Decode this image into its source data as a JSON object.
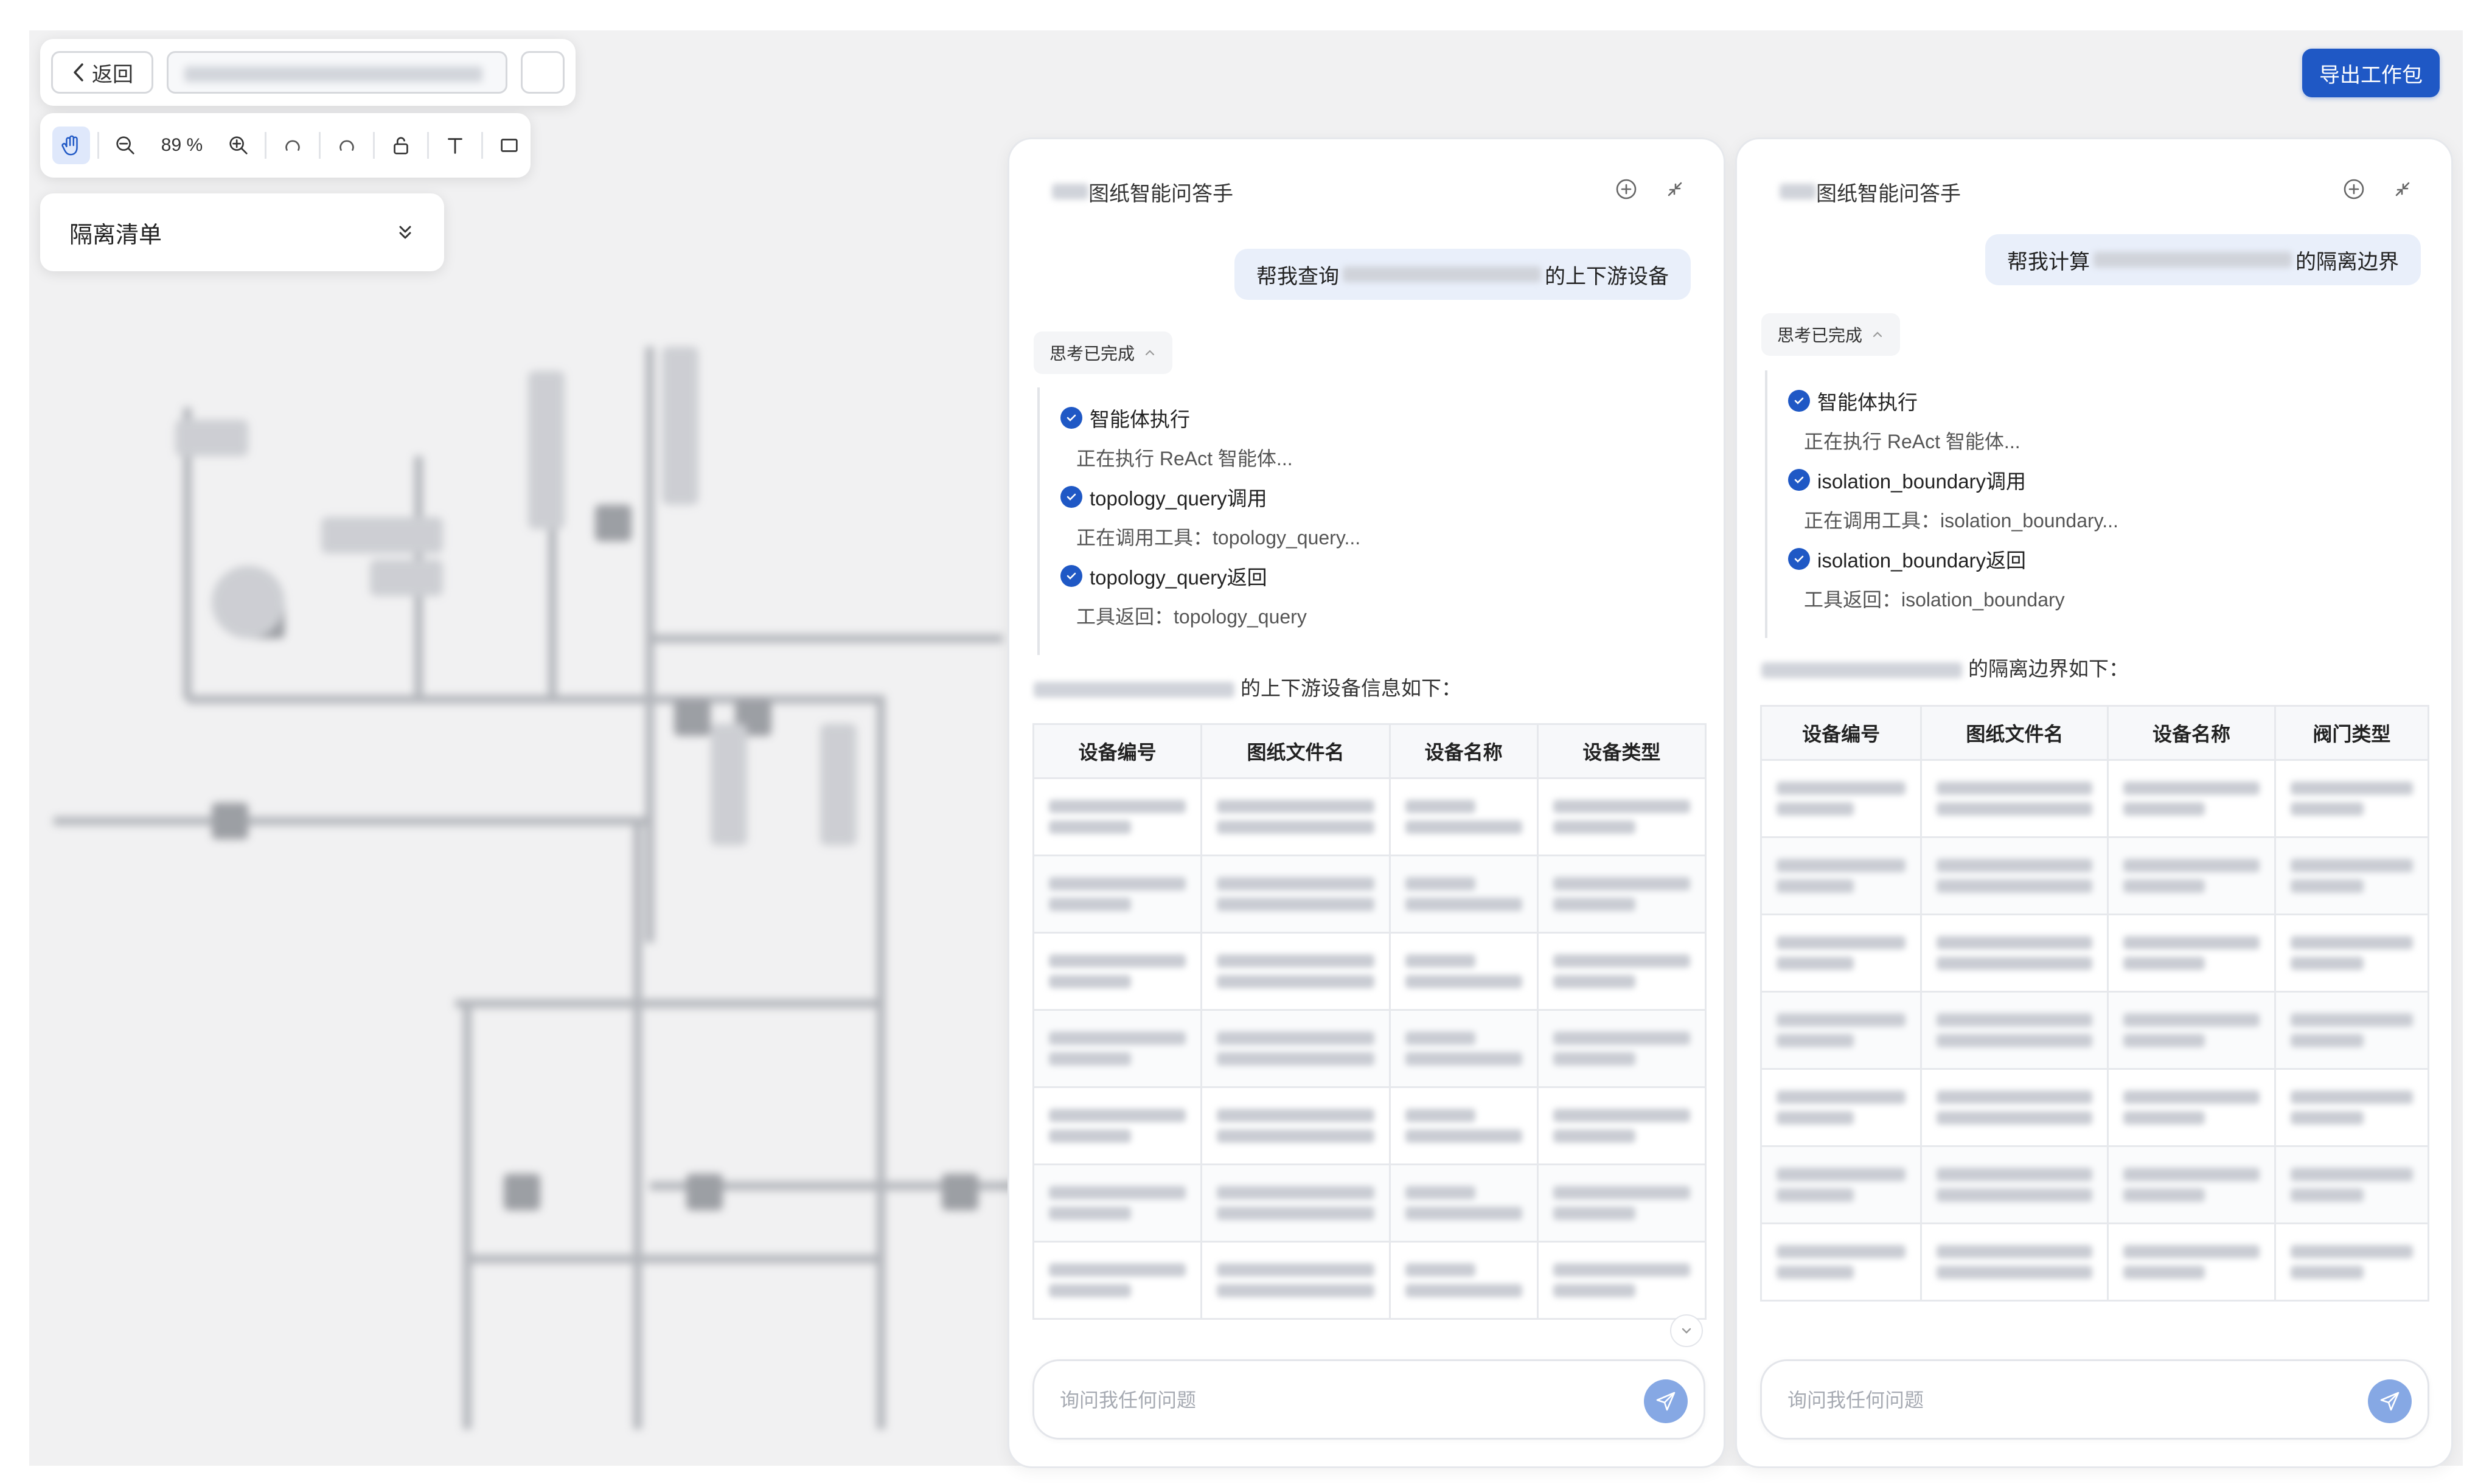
{
  "toolbar": {
    "back_label": "返回",
    "zoom_value": "89 %"
  },
  "isolation_list": {
    "label": "隔离清单"
  },
  "export_label": "导出工作包",
  "left_panel": {
    "title": "图纸智能问答手",
    "user_prefix": "帮我查询",
    "user_suffix": "的上下游设备",
    "think_label": "思考已完成",
    "steps": {
      "s1": "智能体执行",
      "s1_sub": "正在执行 ReAct 智能体...",
      "s2": "topology_query调用",
      "s2_sub": "正在调用工具：topology_query...",
      "s3": "topology_query返回",
      "s3_sub": "工具返回：topology_query"
    },
    "intro_suffix": "的上下游设备信息如下：",
    "table_headers": [
      "设备编号",
      "图纸文件名",
      "设备名称",
      "设备类型"
    ],
    "input_placeholder": "询问我任何问题"
  },
  "right_panel": {
    "title": "图纸智能问答手",
    "user_prefix": "帮我计算",
    "user_suffix": "的隔离边界",
    "think_label": "思考已完成",
    "steps": {
      "s1": "智能体执行",
      "s1_sub": "正在执行 ReAct 智能体...",
      "s2": "isolation_boundary调用",
      "s2_sub": "正在调用工具：isolation_boundary...",
      "s3": "isolation_boundary返回",
      "s3_sub": "工具返回：isolation_boundary"
    },
    "intro_suffix": "的隔离边界如下：",
    "table_headers": [
      "设备编号",
      "图纸文件名",
      "设备名称",
      "阀门类型"
    ],
    "input_placeholder": "询问我任何问题"
  },
  "colors": {
    "accent": "#1f58c5",
    "user_bubble": "#e9effa",
    "send_button": "#86a8e4"
  }
}
